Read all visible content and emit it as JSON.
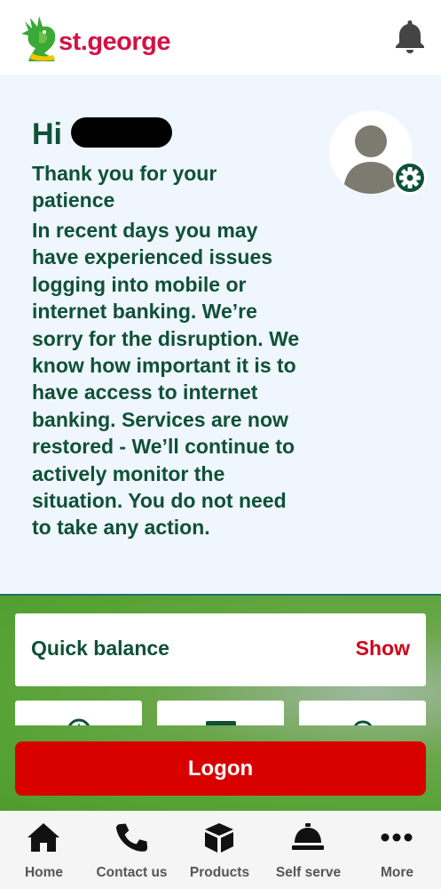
{
  "header": {
    "brand": "st.george",
    "notifications_icon": "bell-icon"
  },
  "message": {
    "greeting": "Hi",
    "title": "Thank you for your patience",
    "body": "In recent days you may have experienced issues logging into mobile or internet banking. We’re sorry for the disruption. We know how important it is to have access to internet banking. Services are now restored - We’ll continue to actively monitor the situation. You do not need to take any action.",
    "avatar_icon": "user-icon",
    "settings_icon": "gear-icon"
  },
  "quick_balance": {
    "label": "Quick balance",
    "action": "Show"
  },
  "tiles": [
    {
      "icon": "compass-icon"
    },
    {
      "icon": "card-icon"
    },
    {
      "icon": "location-icon"
    }
  ],
  "logon": {
    "label": "Logon"
  },
  "nav": [
    {
      "label": "Home",
      "icon": "home-icon"
    },
    {
      "label": "Contact us",
      "icon": "phone-icon"
    },
    {
      "label": "Products",
      "icon": "box-icon"
    },
    {
      "label": "Self serve",
      "icon": "service-bell-icon"
    },
    {
      "label": "More",
      "icon": "more-icon"
    }
  ],
  "colors": {
    "brand_red": "#d31145",
    "primary_green": "#0e5137",
    "logon_red": "#d90000",
    "show_red": "#d0021b",
    "message_bg": "#f0f6fd"
  }
}
